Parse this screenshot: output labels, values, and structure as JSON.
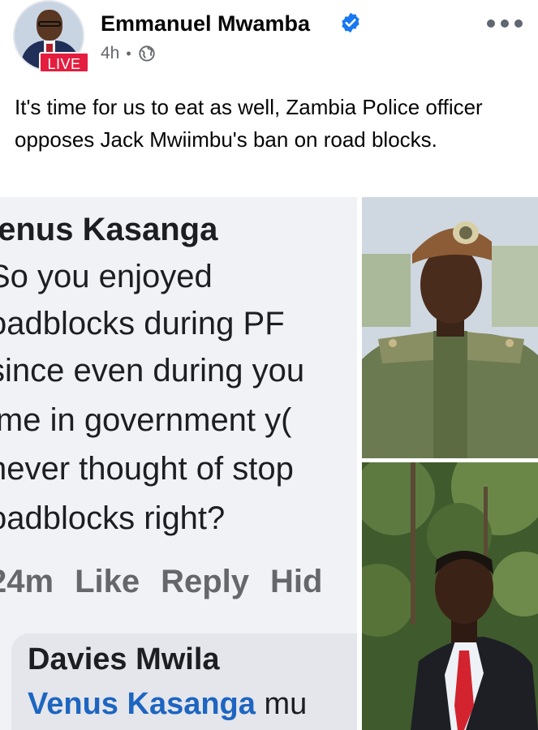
{
  "post": {
    "author": "Emmanuel Mwamba",
    "live_badge": "LIVE",
    "time": "4h",
    "separator": "•",
    "privacy_icon": "globe-icon",
    "verified_icon": "verified-check-icon",
    "more_icon": "more-options-icon",
    "text": "It's time for us to eat as well, Zambia Police officer opposes Jack Mwiimbu's ban on road blocks."
  },
  "screenshot_comment": {
    "name": "/enus Kasanga",
    "lines": [
      "So you enjoyed",
      "oadblocks during PF",
      "since even during you",
      "ime in government y(",
      "never thought of stop",
      "oadblocks right?"
    ],
    "age": "24m",
    "like": "Like",
    "reply": "Reply",
    "hide": "Hid",
    "reply_author": "Davies Mwila",
    "reply_mention": "Venus Kasanga",
    "reply_text": " mu"
  },
  "colors": {
    "live_red": "#e41e3f",
    "verified_blue": "#1877f2",
    "mention_blue": "#1d65c1",
    "meta_gray": "#65676b"
  }
}
